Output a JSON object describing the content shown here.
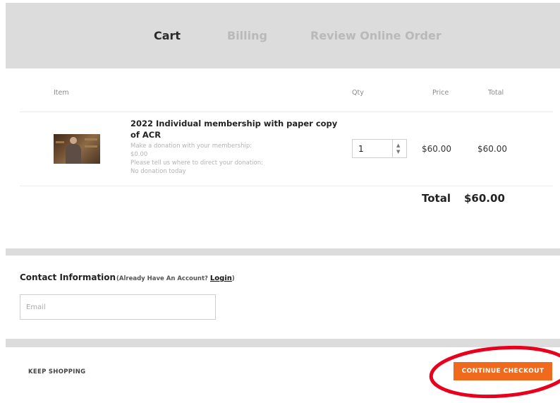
{
  "steps": {
    "cart": "Cart",
    "billing": "Billing",
    "review": "Review Online Order"
  },
  "table_headers": {
    "item": "Item",
    "qty": "Qty",
    "price": "Price",
    "total": "Total"
  },
  "line_item": {
    "title": "2022 Individual membership with paper copy of ACR",
    "donation_label": "Make a donation with your membership:",
    "donation_amount": "$0.00",
    "direct_label": "Please tell us where to direct your donation:",
    "direct_value": "No donation today",
    "quantity": "1",
    "price": "$60.00",
    "line_total": "$60.00"
  },
  "order_total": {
    "label": "Total",
    "value": "$60.00"
  },
  "contact": {
    "title": "Contact Information",
    "account_prefix": "(Already Have An Account? ",
    "login_link": "Login",
    "account_suffix": ")",
    "email_placeholder": "Email",
    "email_value": ""
  },
  "footer": {
    "keep_shopping": "KEEP SHOPPING",
    "continue_checkout": "CONTINUE CHECKOUT"
  },
  "colors": {
    "accent": "#ef6a1c",
    "annotation_circle": "#e8001c",
    "step_active": "#2b2b2b",
    "step_inactive": "#b9b9b9",
    "band_gray": "#dcdcdc"
  },
  "icons": {
    "quantity_up": "chevron-up-icon",
    "quantity_down": "chevron-down-icon",
    "product_thumbnail": "membership-photo"
  }
}
